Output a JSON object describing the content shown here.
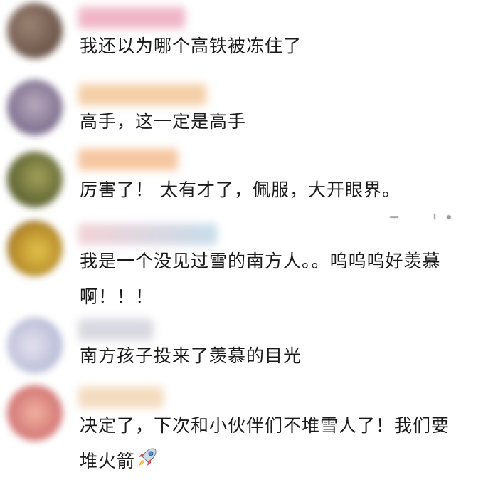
{
  "comments": [
    {
      "text": "我还以为哪个高铁被冻住了",
      "avatar_color": "#7a6458",
      "name_color": "#f0b6c8"
    },
    {
      "text": "高手，这一定是高手",
      "avatar_color": "#9a8fa6",
      "name_color": "#f4cfa8"
    },
    {
      "text": "厉害了！ 太有才了，佩服，大开眼界。",
      "avatar_color": "#6e7a3e",
      "name_color": "#f5c6a0"
    },
    {
      "text": "我是一个没见过雪的南方人。。呜呜呜好羡慕啊！！！",
      "avatar_color": "#c9a43a",
      "name_color": "#c7dcea"
    },
    {
      "text": "南方孩子投来了羡慕的目光",
      "avatar_color": "#c8cce0",
      "name_color": "#d8d8e0"
    },
    {
      "text": "决定了，下次和小伙伴们不堆雪人了！我们要堆火箭",
      "avatar_color": "#d98a8a",
      "name_color": "#f3dcc0"
    }
  ],
  "icons": {
    "last_comment_emoji": "rocket-icon"
  }
}
